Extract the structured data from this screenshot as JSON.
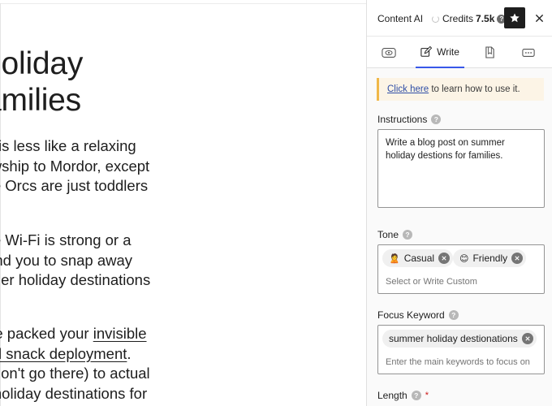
{
  "editor": {
    "title_lines": [
      "holiday",
      "amilies"
    ],
    "paragraph1": [
      "kids is less like a relaxing",
      "ellowship to Mordor, except",
      "d the Orcs are just toddlers"
    ],
    "paragraph2": [
      "e the Wi-Fi is strong or a",
      "n't find you to snap away",
      "ummer holiday destinations"
    ],
    "paragraph3": {
      "line1_prefix": "ou've packed your ",
      "line1_link": "invisible ",
      "line2_link": "ctical snack deployment",
      "line2_suffix": ".",
      "line3": "ng, don't go there) to actual",
      "line4": "ner holiday destinations for"
    }
  },
  "sidebar": {
    "title": "Content AI",
    "credits_label": "Credits",
    "credits_value": "7.5k",
    "tabs": [
      {
        "name": "preview-tab",
        "label": ""
      },
      {
        "name": "write-tab",
        "label": "Write"
      },
      {
        "name": "document-tab",
        "label": ""
      },
      {
        "name": "chat-tab",
        "label": ""
      }
    ],
    "notice": {
      "link": "Click here",
      "text": " to learn how to use it."
    },
    "instructions": {
      "label": "Instructions",
      "value": "Write a blog post on summer holiday destions for families."
    },
    "tone": {
      "label": "Tone",
      "chips": [
        {
          "emoji": "🙎",
          "label": "Casual"
        },
        {
          "emoji": "😊",
          "label": "Friendly"
        }
      ],
      "placeholder": "Select or Write Custom"
    },
    "focus_keyword": {
      "label": "Focus Keyword",
      "chips": [
        {
          "label": "summer holiday destionations"
        }
      ],
      "placeholder": "Enter the main keywords to focus on"
    },
    "length": {
      "label": "Length",
      "required_mark": "*"
    }
  },
  "colors": {
    "accent": "#3858e9",
    "notice_bg": "#fcf4e6",
    "notice_border": "#f0b849",
    "required": "#cc1818"
  }
}
